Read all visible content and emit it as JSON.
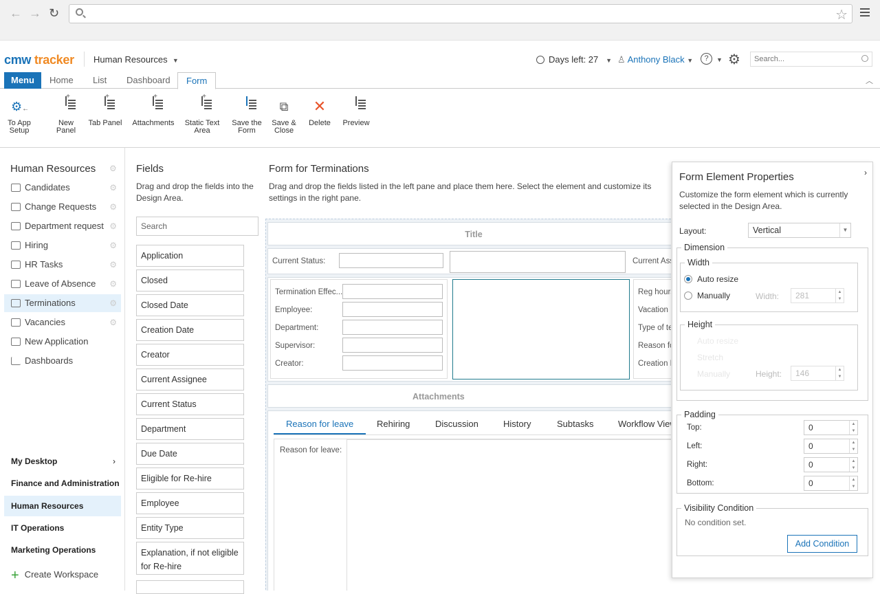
{
  "browser": {
    "url": ""
  },
  "header": {
    "logo_cmw": "cmw",
    "logo_tracker": "tracker",
    "workspace": "Human Resources",
    "days_left": "Days left: 27",
    "user": "Anthony Black",
    "search_placeholder": "Search..."
  },
  "tabs": {
    "menu": "Menu",
    "home": "Home",
    "list": "List",
    "dashboard": "Dashboard",
    "form": "Form"
  },
  "ribbon": {
    "to_app_setup": "To App Setup",
    "new_panel": "New Panel",
    "tab_panel": "Tab Panel",
    "attachments": "Attachments",
    "static_text_area": "Static Text Area",
    "save_form": "Save the Form",
    "save_close": "Save & Close",
    "delete": "Delete",
    "preview": "Preview"
  },
  "leftnav": {
    "title": "Human Resources",
    "items": [
      "Candidates",
      "Change Requests",
      "Department request",
      "Hiring",
      "HR Tasks",
      "Leave of Absence",
      "Terminations",
      "Vacancies",
      "New Application",
      "Dashboards"
    ],
    "workspaces": [
      "My Desktop",
      "Finance and Administration",
      "Human Resources",
      "IT Operations",
      "Marketing Operations"
    ],
    "create_workspace": "Create Workspace"
  },
  "fields": {
    "title": "Fields",
    "description": "Drag and drop the fields into the Design Area.",
    "search_placeholder": "Search",
    "items": [
      "Application",
      "Closed",
      "Closed Date",
      "Creation Date",
      "Creator",
      "Current Assignee",
      "Current Status",
      "Department",
      "Due Date",
      "Eligible for Re-hire",
      "Employee",
      "Entity Type",
      "Explanation, if not eligible for Re-hire"
    ]
  },
  "design": {
    "title": "Form for Terminations",
    "description": "Drag and drop the fields listed in the left pane and place them here. Select the element and customize its settings in the right pane.",
    "form_title": "Title",
    "current_status": "Current Status:",
    "current_assignee": "Current Ass",
    "left_labels": [
      "Termination Effec...",
      "Employee:",
      "Department:",
      "Supervisor:",
      "Creator:"
    ],
    "right_labels": [
      "Reg hours",
      "Vacation H",
      "Type of te",
      "Reason fo",
      "Creation D"
    ],
    "attachments": "Attachments",
    "tabs": [
      "Reason for leave",
      "Rehiring",
      "Discussion",
      "History",
      "Subtasks",
      "Workflow View"
    ],
    "reason_label": "Reason for leave:"
  },
  "props": {
    "title": "Form Element Properties",
    "description": "Customize the form element which is currently selected in the Design Area.",
    "layout_label": "Layout:",
    "layout_value": "Vertical",
    "dimension": "Dimension",
    "width": "Width",
    "auto_resize": "Auto resize",
    "manually": "Manually",
    "width_label": "Width:",
    "width_value": "281",
    "height": "Height",
    "stretch": "Stretch",
    "height_label": "Height:",
    "height_value": "146",
    "padding": "Padding",
    "top": "Top:",
    "left": "Left:",
    "right": "Right:",
    "bottom": "Bottom:",
    "top_val": "0",
    "left_val": "0",
    "right_val": "0",
    "bottom_val": "0",
    "visibility": "Visibility Condition",
    "no_condition": "No condition set.",
    "add_condition": "Add Condition"
  },
  "colors": {
    "accent": "#1a73b8",
    "brand_orange": "#f08a24",
    "delete_red": "#e8542a"
  }
}
